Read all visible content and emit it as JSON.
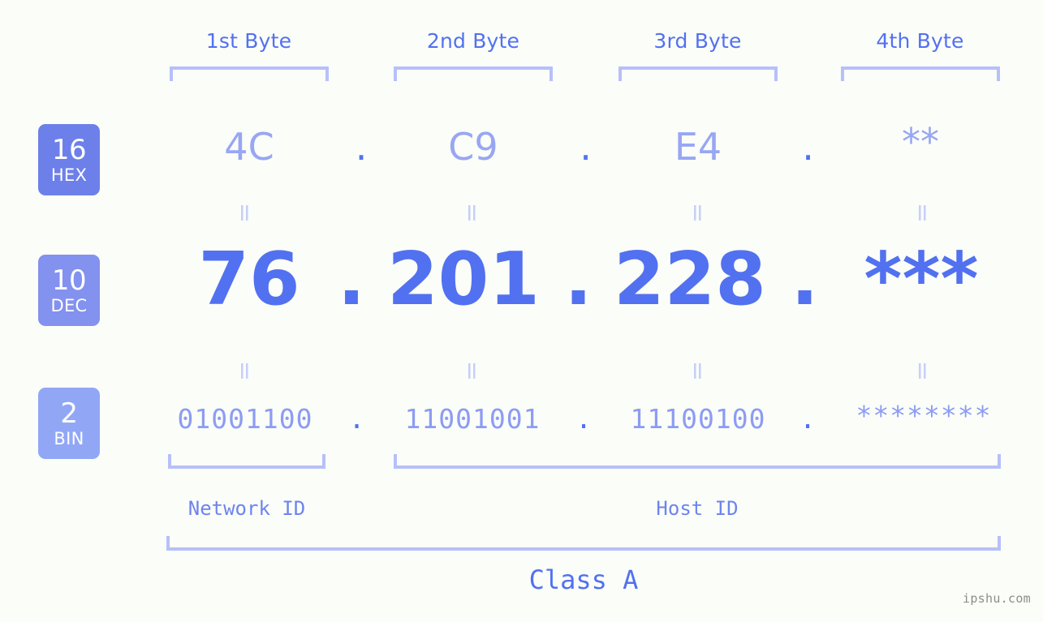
{
  "background_color": "#fbfdf8",
  "accent_color": "#5271f0",
  "accent_light": "#98a6f3",
  "bracket_color": "#b6c0fb",
  "byte_headers": [
    {
      "label": "1st Byte"
    },
    {
      "label": "2nd Byte"
    },
    {
      "label": "3rd Byte"
    },
    {
      "label": "4th Byte"
    }
  ],
  "bases": [
    {
      "number": "16",
      "name": "HEX",
      "color": "#6d80e9"
    },
    {
      "number": "10",
      "name": "DEC",
      "color": "#8391ef"
    },
    {
      "number": "2",
      "name": "BIN",
      "color": "#91a7f6"
    }
  ],
  "rows": {
    "hex": {
      "values": [
        "4C",
        "C9",
        "E4",
        "**"
      ],
      "separator": "."
    },
    "dec": {
      "values": [
        "76",
        "201",
        "228",
        "***"
      ],
      "separator": "."
    },
    "bin": {
      "values": [
        "01001100",
        "11001001",
        "11100100",
        "********"
      ],
      "separator": "."
    }
  },
  "equals_mark": "=",
  "segments": [
    {
      "label": "Network ID"
    },
    {
      "label": "Host ID"
    }
  ],
  "class": {
    "label": "Class A"
  },
  "watermark": {
    "text": "ipshu.com"
  },
  "chart_data": {
    "type": "table",
    "title": "IP Address Byte Breakdown - Class A",
    "columns": [
      "1st Byte",
      "2nd Byte",
      "3rd Byte",
      "4th Byte"
    ],
    "rows": [
      {
        "base": "16 HEX",
        "cells": [
          "4C",
          "C9",
          "E4",
          "**"
        ]
      },
      {
        "base": "10 DEC",
        "cells": [
          "76",
          "201",
          "228",
          "***"
        ]
      },
      {
        "base": "2 BIN",
        "cells": [
          "01001100",
          "11001001",
          "11100100",
          "********"
        ]
      }
    ],
    "groupings": [
      {
        "name": "Network ID",
        "bytes": [
          1
        ]
      },
      {
        "name": "Host ID",
        "bytes": [
          2,
          3,
          4
        ]
      },
      {
        "name": "Class A",
        "bytes": [
          1,
          2,
          3,
          4
        ]
      }
    ]
  }
}
